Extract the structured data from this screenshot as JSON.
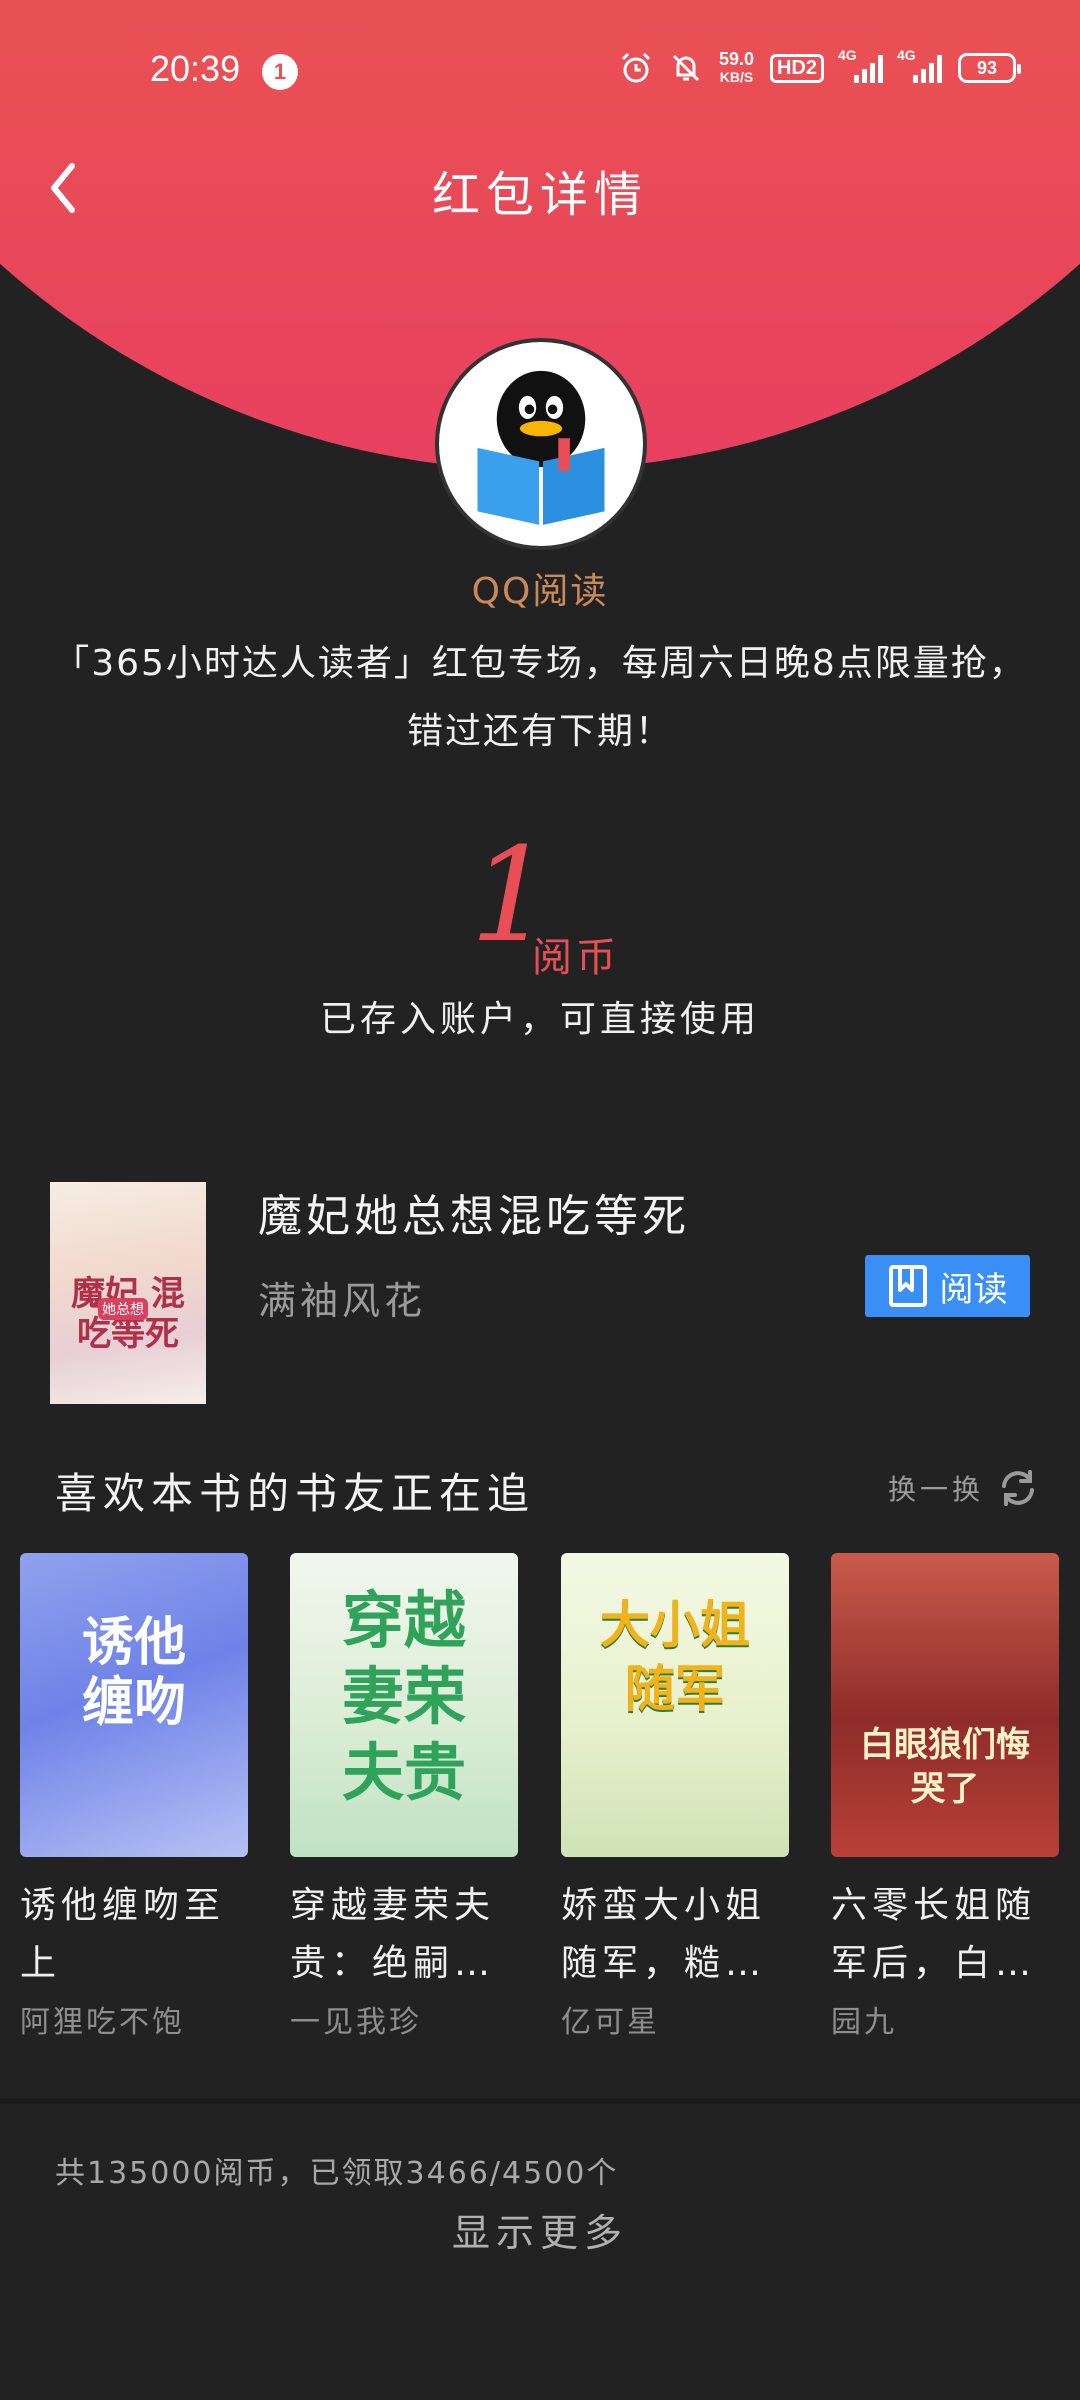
{
  "status_bar": {
    "time": "20:39",
    "notification_count": "1",
    "net_speed": "59.0",
    "net_speed_unit": "KB/S",
    "hd_label": "HD2",
    "signal1_label": "4G",
    "signal2_label": "4G",
    "battery": "93"
  },
  "header": {
    "title": "红包详情"
  },
  "sender": {
    "name": "QQ阅读"
  },
  "message": "「365小时达人读者」红包专场，每周六日晚8点限量抢，错过还有下期！",
  "reward": {
    "amount": "1",
    "unit": "阅币",
    "note": "已存入账户，可直接使用"
  },
  "book": {
    "title": "魔妃她总想混吃等死",
    "author": "满袖风花",
    "read_label": "阅读",
    "cover_text": "魔妃 混吃等死",
    "cover_badge": "她总想"
  },
  "recommend": {
    "section_title": "喜欢本书的书友正在追",
    "swap_label": "换一换",
    "items": [
      {
        "title": "诱他缠吻至上",
        "author": "阿狸吃不饱",
        "cover_text": "诱他缠吻"
      },
      {
        "title": "穿越妻荣夫贵：绝嗣…",
        "author": "一见我珍",
        "cover_text": "穿越妻荣夫贵"
      },
      {
        "title": "娇蛮大小姐随军，糙…",
        "author": "亿可星",
        "cover_text": "大小姐随军"
      },
      {
        "title": "六零长姐随军后，白…",
        "author": "园九",
        "cover_text": "白眼狼们悔哭了"
      }
    ]
  },
  "footer": {
    "summary": "共135000阅币，已领取3466/4500个",
    "show_more": "显示更多"
  }
}
